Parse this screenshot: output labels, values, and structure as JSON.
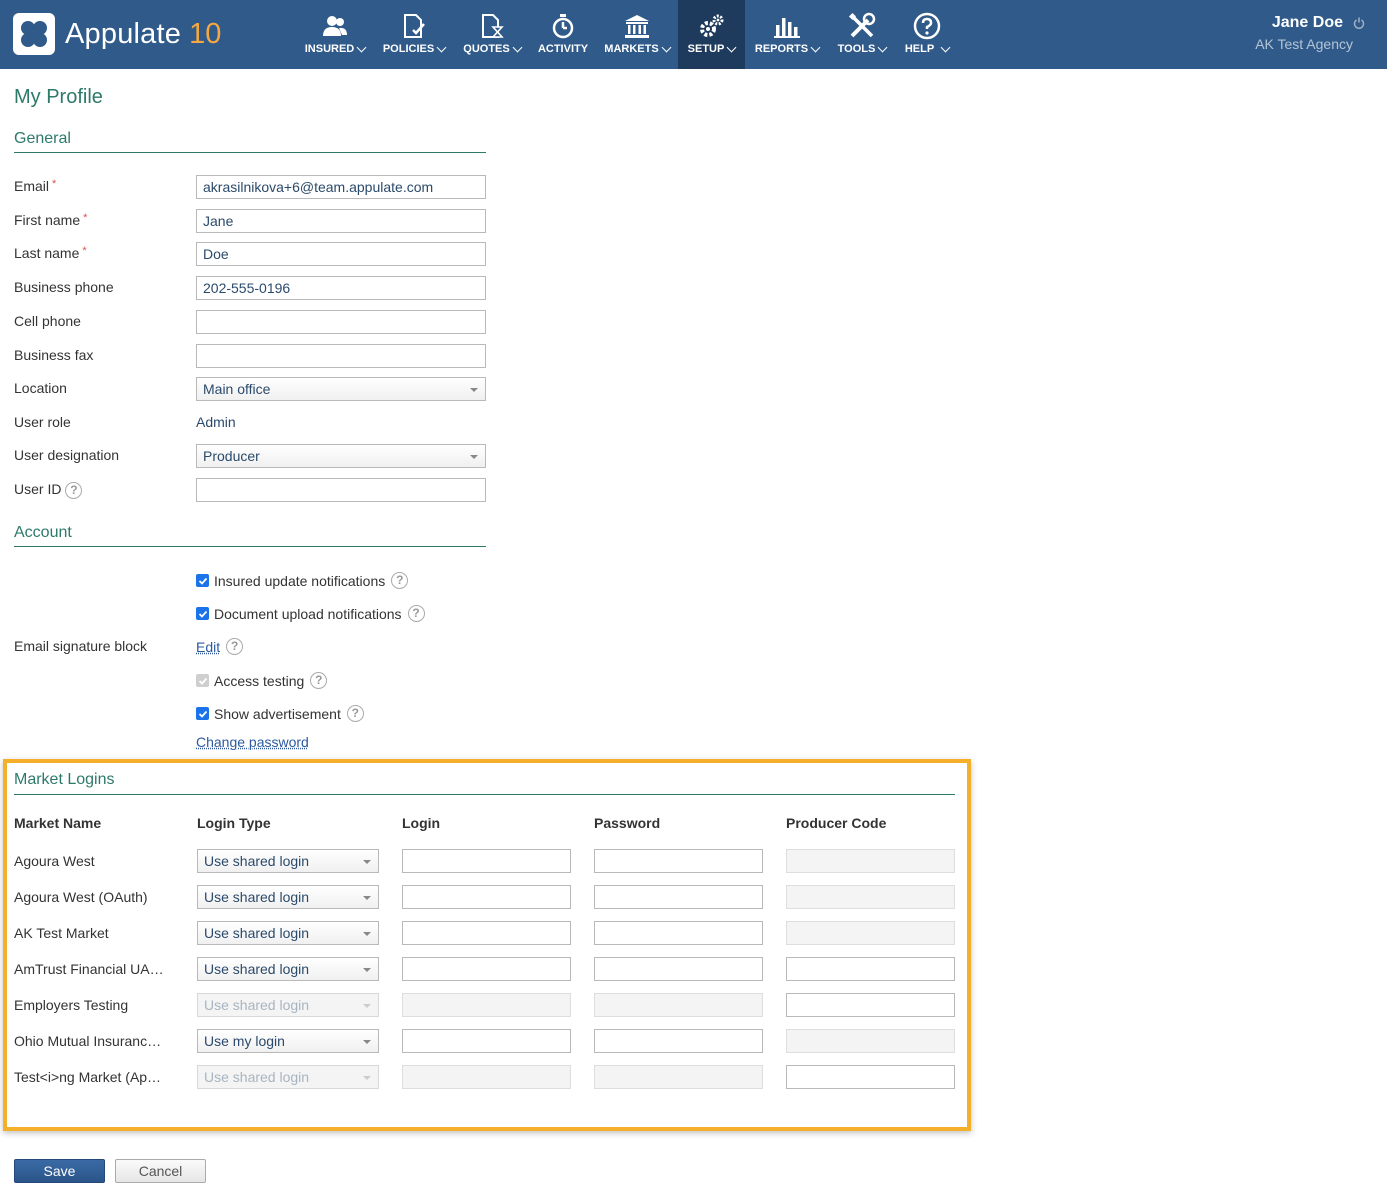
{
  "brand": {
    "name": "Appulate",
    "version": "10"
  },
  "nav": [
    {
      "label": "INSURED",
      "icon": "users-icon",
      "dropdown": true
    },
    {
      "label": "POLICIES",
      "icon": "policy-document-icon",
      "dropdown": true
    },
    {
      "label": "QUOTES",
      "icon": "quote-hourglass-icon",
      "dropdown": true
    },
    {
      "label": "ACTIVITY",
      "icon": "stopwatch-icon",
      "dropdown": false
    },
    {
      "label": "MARKETS",
      "icon": "bank-building-icon",
      "dropdown": true
    },
    {
      "label": "SETUP",
      "icon": "gears-icon",
      "dropdown": true,
      "active": true
    },
    {
      "label": "REPORTS",
      "icon": "bar-chart-icon",
      "dropdown": true
    },
    {
      "label": "TOOLS",
      "icon": "tools-icon",
      "dropdown": true
    },
    {
      "label": "HELP",
      "icon": "question-circle-icon",
      "dropdown": true
    }
  ],
  "user": {
    "name": "Jane Doe",
    "agency": "AK Test Agency"
  },
  "page": {
    "title": "My Profile"
  },
  "general": {
    "heading": "General",
    "email": {
      "label": "Email",
      "value": "akrasilnikova+6@team.appulate.com"
    },
    "first_name": {
      "label": "First name",
      "value": "Jane"
    },
    "last_name": {
      "label": "Last name",
      "value": "Doe"
    },
    "business_phone": {
      "label": "Business phone",
      "value": "202-555-0196"
    },
    "cell_phone": {
      "label": "Cell phone",
      "value": ""
    },
    "business_fax": {
      "label": "Business fax",
      "value": ""
    },
    "location": {
      "label": "Location",
      "value": "Main office"
    },
    "user_role": {
      "label": "User role",
      "value": "Admin"
    },
    "user_designation": {
      "label": "User designation",
      "value": "Producer"
    },
    "user_id": {
      "label": "User ID",
      "value": ""
    }
  },
  "account": {
    "heading": "Account",
    "insured_update": {
      "label": "Insured update notifications",
      "checked": true
    },
    "document_upload": {
      "label": "Document upload notifications",
      "checked": true
    },
    "email_signature": {
      "label": "Email signature block",
      "link": "Edit"
    },
    "access_testing": {
      "label": "Access testing",
      "checked": true,
      "disabled": true
    },
    "show_ads": {
      "label": "Show advertisement",
      "checked": true
    },
    "change_password": "Change password"
  },
  "market_logins": {
    "heading": "Market Logins",
    "columns": [
      "Market Name",
      "Login Type",
      "Login",
      "Password",
      "Producer Code"
    ],
    "rows": [
      {
        "market": "Agoura West",
        "login_type": "Use shared login",
        "type_disabled": false,
        "login_disabled": false,
        "password_disabled": false,
        "code_disabled": true
      },
      {
        "market": "Agoura West (OAuth)",
        "login_type": "Use shared login",
        "type_disabled": false,
        "login_disabled": false,
        "password_disabled": false,
        "code_disabled": true
      },
      {
        "market": "AK Test Market",
        "login_type": "Use shared login",
        "type_disabled": false,
        "login_disabled": false,
        "password_disabled": false,
        "code_disabled": true
      },
      {
        "market": "AmTrust Financial UA…",
        "login_type": "Use shared login",
        "type_disabled": false,
        "login_disabled": false,
        "password_disabled": false,
        "code_disabled": false
      },
      {
        "market": "Employers Testing",
        "login_type": "Use shared login",
        "type_disabled": true,
        "login_disabled": true,
        "password_disabled": true,
        "code_disabled": false
      },
      {
        "market": "Ohio Mutual Insuranc…",
        "login_type": "Use my login",
        "type_disabled": false,
        "login_disabled": false,
        "password_disabled": false,
        "code_disabled": true
      },
      {
        "market": "Test<i>ng Market (Ap…",
        "login_type": "Use shared login",
        "type_disabled": true,
        "login_disabled": true,
        "password_disabled": true,
        "code_disabled": false
      }
    ]
  },
  "actions": {
    "save": "Save",
    "cancel": "Cancel"
  }
}
